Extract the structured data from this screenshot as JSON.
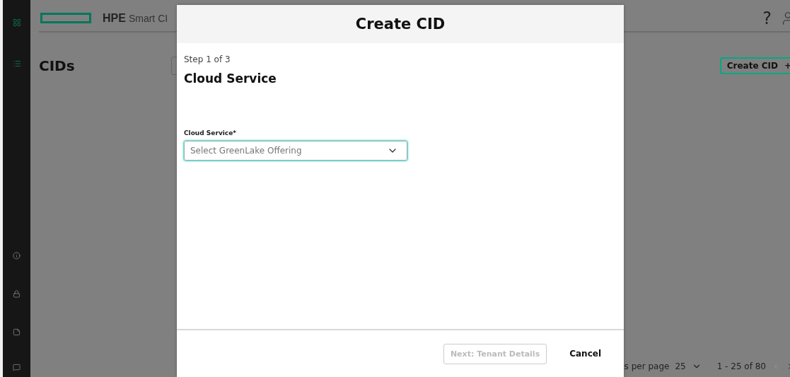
{
  "app": {
    "brand": "HPE",
    "product": "Smart CI"
  },
  "header_icons": [
    "?"
  ],
  "page": {
    "title": "CIDs",
    "create_button": "Create CID",
    "create_icon": "+"
  },
  "pagination": {
    "rows_label": "s per page",
    "rows_value": "25",
    "range": "1 - 25 of 80"
  },
  "dialog": {
    "title": "Create CID",
    "step": "Step 1 of 3",
    "heading": "Cloud Service",
    "field": {
      "label": "Cloud Service*",
      "placeholder": "Select GreenLake Offering",
      "focused": true
    },
    "next_button": {
      "label": "Next: Tenant Details",
      "disabled": true
    },
    "cancel_button": "Cancel"
  }
}
